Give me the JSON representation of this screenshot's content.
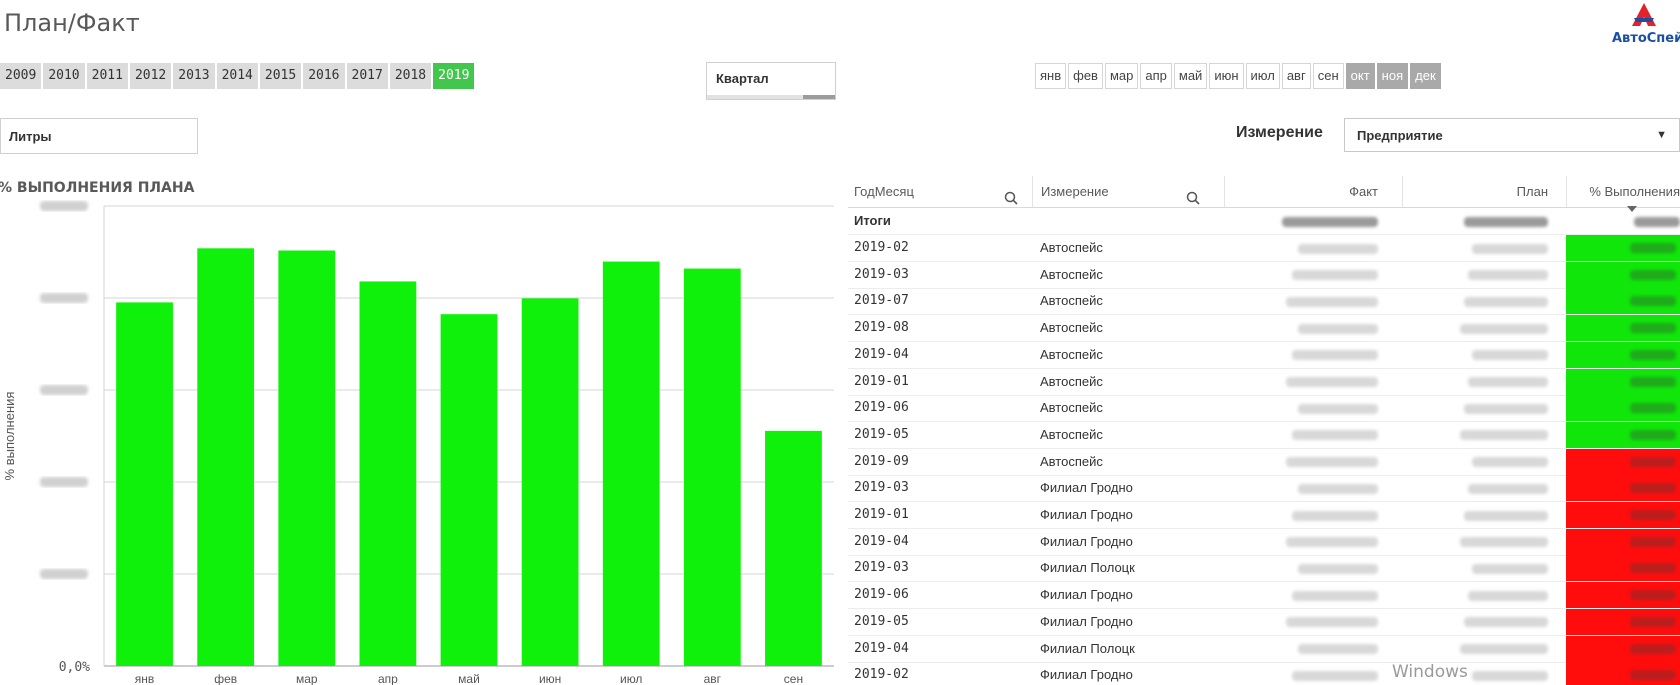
{
  "app": {
    "title": "План/Факт",
    "logo_text": "АвтоСпейс"
  },
  "years": [
    {
      "label": "2009",
      "selected": false
    },
    {
      "label": "2010",
      "selected": false
    },
    {
      "label": "2011",
      "selected": false
    },
    {
      "label": "2012",
      "selected": false
    },
    {
      "label": "2013",
      "selected": false
    },
    {
      "label": "2014",
      "selected": false
    },
    {
      "label": "2015",
      "selected": false
    },
    {
      "label": "2016",
      "selected": false
    },
    {
      "label": "2017",
      "selected": false
    },
    {
      "label": "2018",
      "selected": false
    },
    {
      "label": "2019",
      "selected": true
    }
  ],
  "quarter_filter": {
    "label": "Квартал"
  },
  "months": [
    {
      "label": "янв",
      "disabled": false
    },
    {
      "label": "фев",
      "disabled": false
    },
    {
      "label": "мар",
      "disabled": false
    },
    {
      "label": "апр",
      "disabled": false
    },
    {
      "label": "май",
      "disabled": false
    },
    {
      "label": "июн",
      "disabled": false
    },
    {
      "label": "июл",
      "disabled": false
    },
    {
      "label": "авг",
      "disabled": false
    },
    {
      "label": "сен",
      "disabled": false
    },
    {
      "label": "окт",
      "disabled": true
    },
    {
      "label": "ноя",
      "disabled": true
    },
    {
      "label": "дек",
      "disabled": true
    }
  ],
  "unit_filter": {
    "label": "Литры"
  },
  "dimension": {
    "label": "Измерение",
    "value": "Предприятие"
  },
  "chart_data": {
    "type": "bar",
    "title": "% ВЫПОЛНЕНИЯ ПЛАНА",
    "ylabel": "% выполнения",
    "xlabel": "",
    "categories": [
      "янв",
      "фев",
      "мар",
      "апр",
      "май",
      "июн",
      "июл",
      "авг",
      "сен"
    ],
    "values": [
      98.8,
      113.5,
      112.9,
      104.5,
      95.6,
      99.9,
      109.9,
      108.0,
      63.9
    ],
    "ylim": [
      0,
      125
    ],
    "yticks_visible": [
      "0,0%"
    ],
    "grid": true,
    "bar_color": "#0ff00a"
  },
  "table": {
    "columns": [
      "ГодМесяц",
      "Измерение",
      "Факт",
      "План",
      "% Выполнения"
    ],
    "totals_label": "Итоги",
    "rows": [
      {
        "period": "2019-02",
        "dimension": "Автоспейс",
        "status": "green"
      },
      {
        "period": "2019-03",
        "dimension": "Автоспейс",
        "status": "green"
      },
      {
        "period": "2019-07",
        "dimension": "Автоспейс",
        "status": "green"
      },
      {
        "period": "2019-08",
        "dimension": "Автоспейс",
        "status": "green"
      },
      {
        "period": "2019-04",
        "dimension": "Автоспейс",
        "status": "green"
      },
      {
        "period": "2019-01",
        "dimension": "Автоспейс",
        "status": "green"
      },
      {
        "period": "2019-06",
        "dimension": "Автоспейс",
        "status": "green"
      },
      {
        "period": "2019-05",
        "dimension": "Автоспейс",
        "status": "green"
      },
      {
        "period": "2019-09",
        "dimension": "Автоспейс",
        "status": "red"
      },
      {
        "period": "2019-03",
        "dimension": "Филиал Гродно",
        "status": "red"
      },
      {
        "period": "2019-01",
        "dimension": "Филиал Гродно",
        "status": "red"
      },
      {
        "period": "2019-04",
        "dimension": "Филиал Гродно",
        "status": "red"
      },
      {
        "period": "2019-03",
        "dimension": "Филиал Полоцк",
        "status": "red"
      },
      {
        "period": "2019-06",
        "dimension": "Филиал Гродно",
        "status": "red"
      },
      {
        "period": "2019-05",
        "dimension": "Филиал Гродно",
        "status": "red"
      },
      {
        "period": "2019-04",
        "dimension": "Филиал Полоцк",
        "status": "red"
      },
      {
        "period": "2019-02",
        "dimension": "Филиал Гродно",
        "status": "red"
      }
    ],
    "status_colors": {
      "green": "#10e60a",
      "red": "#ff0d0d"
    }
  },
  "os": {
    "watermark": "Windows"
  }
}
